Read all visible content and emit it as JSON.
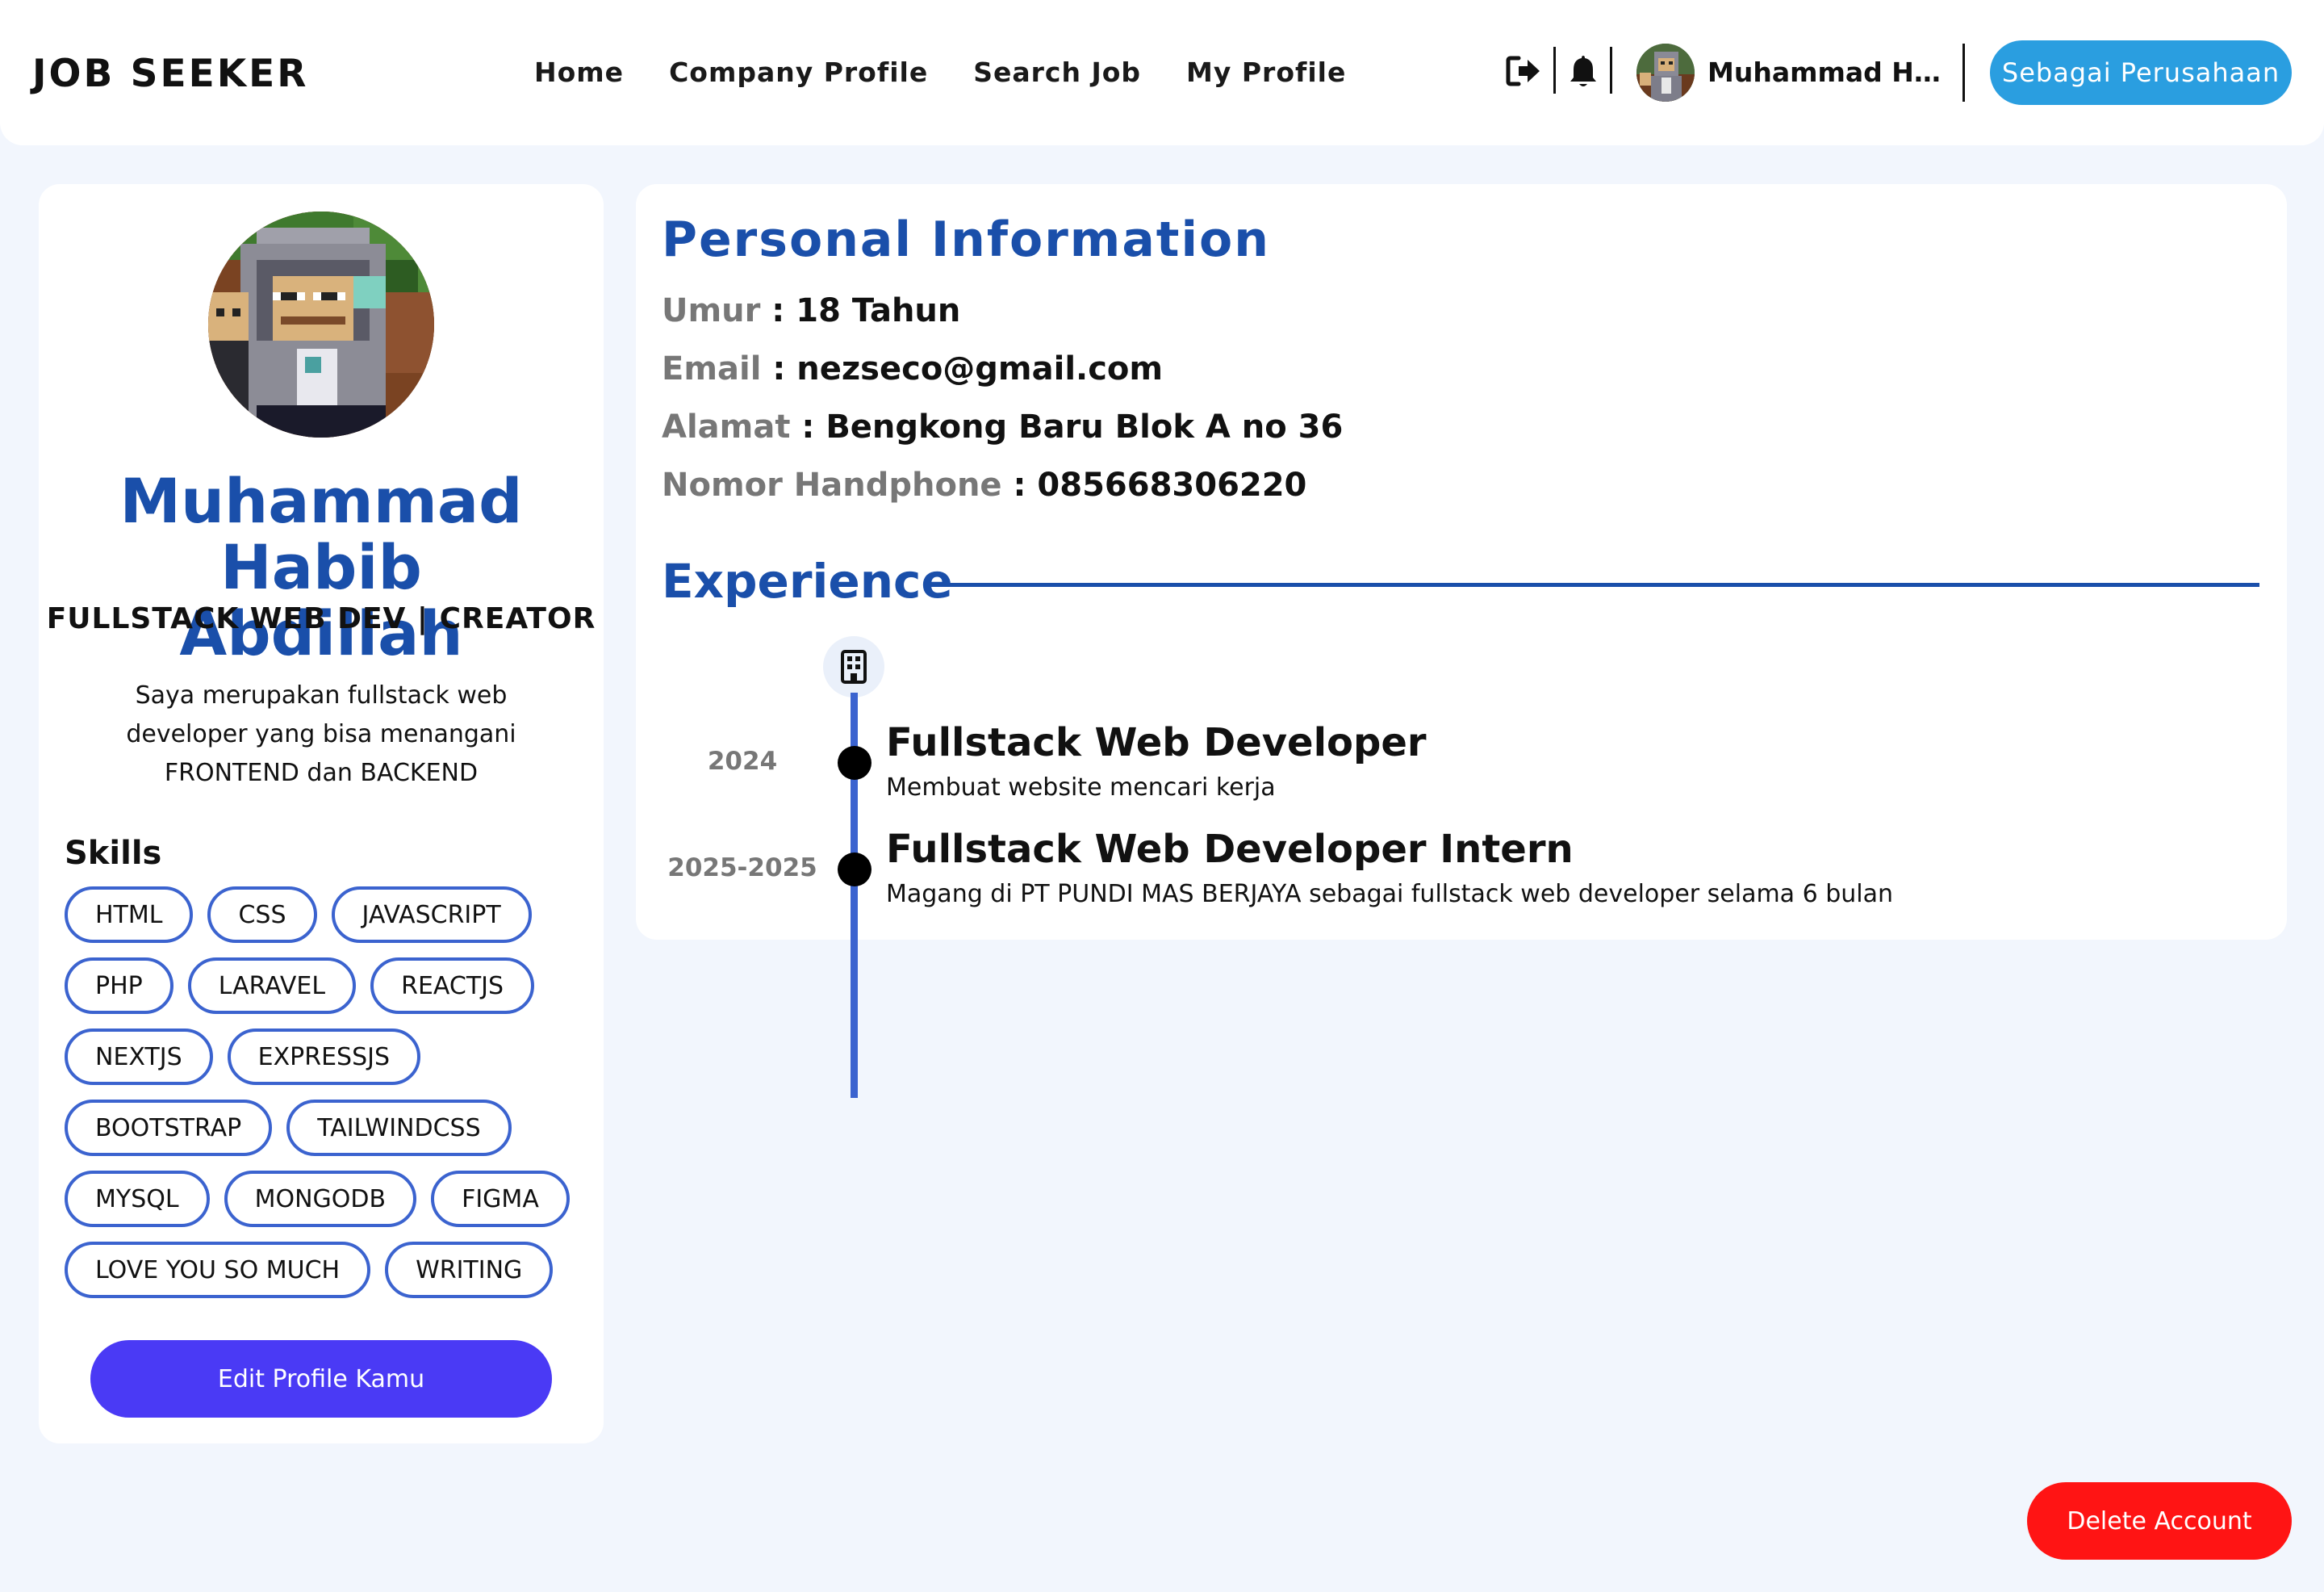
{
  "navbar": {
    "brand": "JOB SEEKER",
    "links": [
      "Home",
      "Company Profile",
      "Search Job",
      "My Profile"
    ],
    "icons": [
      "logout-icon",
      "bell-icon"
    ],
    "username": "Muhammad Habib...",
    "company_button": "Sebagai Perusahaan"
  },
  "profile": {
    "name": "Muhammad Habib Abdillah",
    "role": "FULLSTACK WEB DEV | CREATOR",
    "bio": "Saya merupakan fullstack web developer yang bisa menangani FRONTEND dan BACKEND",
    "skills_title": "Skills",
    "skills": [
      "HTML",
      "CSS",
      "JAVASCRIPT",
      "PHP",
      "LARAVEL",
      "REACTJS",
      "NEXTJS",
      "EXPRESSJS",
      "BOOTSTRAP",
      "TAILWINDCSS",
      "MYSQL",
      "MONGODB",
      "FIGMA",
      "LOVE YOU SO MUCH",
      "WRITING"
    ],
    "edit_button": "Edit Profile Kamu"
  },
  "personal_info": {
    "title": "Personal Information",
    "fields": [
      {
        "label": "Umur",
        "value": "18 Tahun"
      },
      {
        "label": "Email",
        "value": "nezseco@gmail.com"
      },
      {
        "label": "Alamat",
        "value": "Bengkong Baru Blok A no 36"
      },
      {
        "label": "Nomor Handphone",
        "value": "085668306220"
      }
    ]
  },
  "experience": {
    "title": "Experience",
    "items": [
      {
        "year": "2024",
        "position": "Fullstack Web Developer",
        "description": "Membuat website mencari kerja"
      },
      {
        "year": "2025-2025",
        "position": "Fullstack Web Developer Intern",
        "description": "Magang di PT PUNDI MAS BERJAYA sebagai fullstack web developer selama 6 bulan"
      }
    ]
  },
  "delete_button": "Delete Account",
  "colors": {
    "accent_blue": "#1a4faa",
    "skill_border": "#3b63cf",
    "company_button": "#2a9ee0",
    "edit_button": "#4a3af5",
    "delete_button": "#ff1414",
    "page_bg": "#f2f6fd"
  }
}
